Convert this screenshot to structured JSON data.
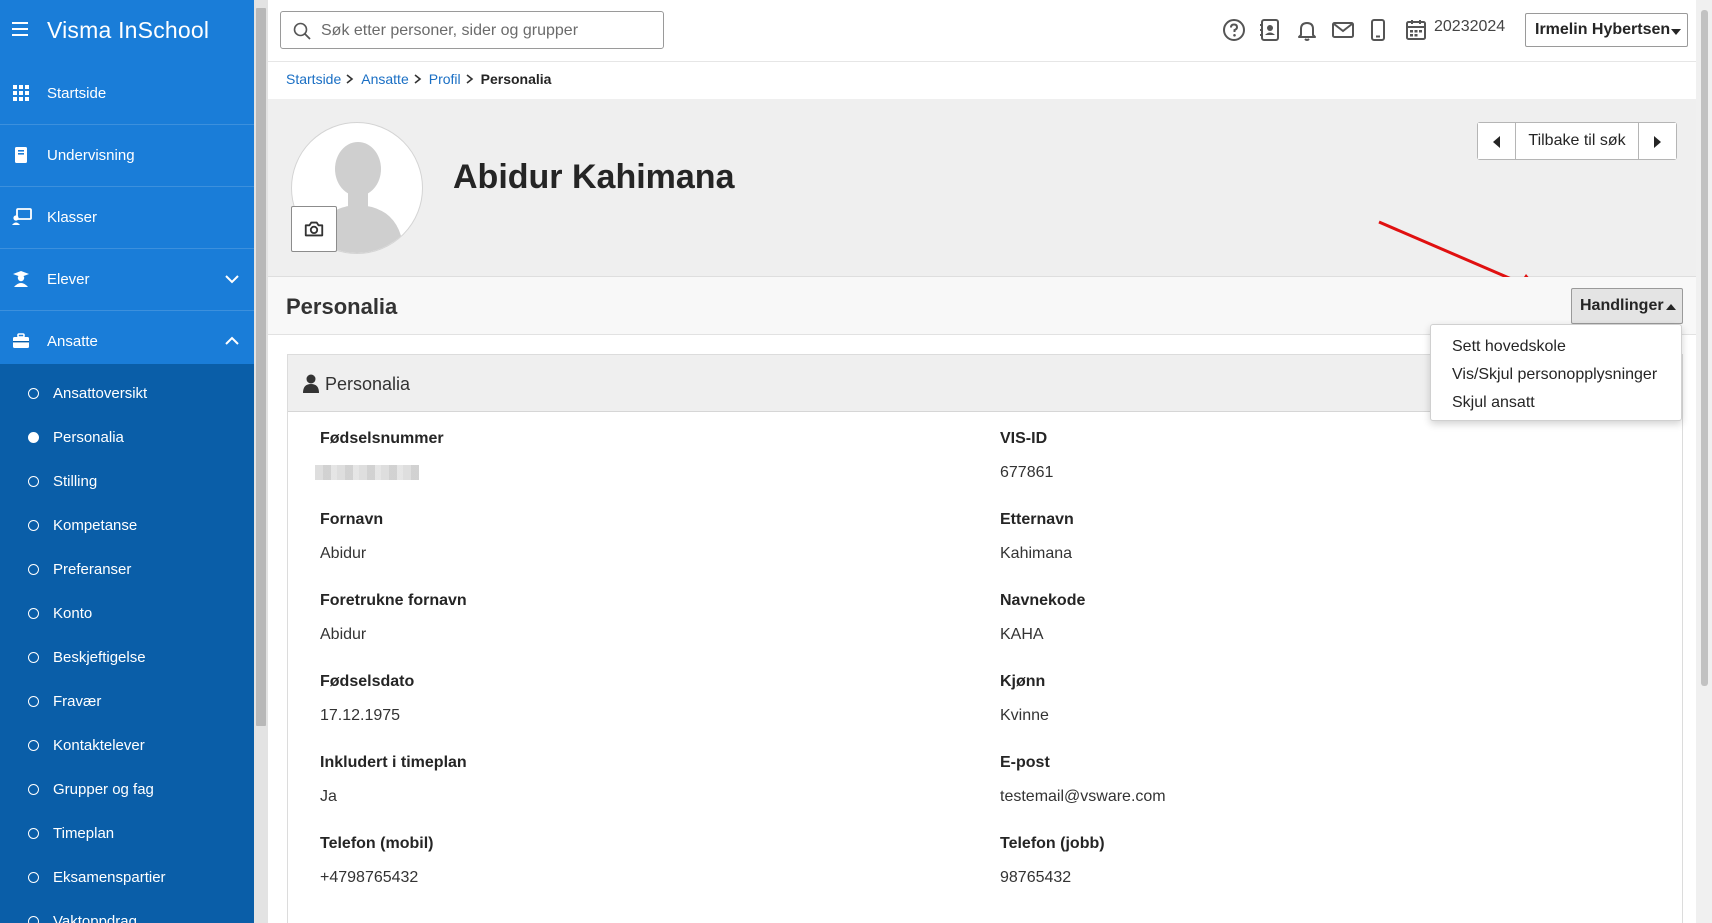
{
  "app": {
    "title": "Visma InSchool"
  },
  "sidebar": {
    "items": [
      {
        "label": "Startside"
      },
      {
        "label": "Undervisning"
      },
      {
        "label": "Klasser"
      },
      {
        "label": "Elever"
      },
      {
        "label": "Ansatte"
      }
    ],
    "subitems": [
      {
        "label": "Ansattoversikt",
        "active": false
      },
      {
        "label": "Personalia",
        "active": true
      },
      {
        "label": "Stilling",
        "active": false
      },
      {
        "label": "Kompetanse",
        "active": false
      },
      {
        "label": "Preferanser",
        "active": false
      },
      {
        "label": "Konto",
        "active": false
      },
      {
        "label": "Beskjeftigelse",
        "active": false
      },
      {
        "label": "Fravær",
        "active": false
      },
      {
        "label": "Kontaktelever",
        "active": false
      },
      {
        "label": "Grupper og fag",
        "active": false
      },
      {
        "label": "Timeplan",
        "active": false
      },
      {
        "label": "Eksamenspartier",
        "active": false
      },
      {
        "label": "Vaktoppdrag",
        "active": false
      }
    ]
  },
  "topbar": {
    "search_placeholder": "Søk etter personer, sider og grupper",
    "school_year": "20232024",
    "user_name": "Irmelin Hybertsen"
  },
  "breadcrumb": {
    "items": [
      "Startside",
      "Ansatte",
      "Profil"
    ],
    "current": "Personalia"
  },
  "profile": {
    "name": "Abidur Kahimana",
    "back_label": "Tilbake til søk"
  },
  "section": {
    "title": "Personalia",
    "actions_label": "Handlinger",
    "actions_menu": [
      "Sett hovedskole",
      "Vis/Skjul personopplysninger",
      "Skjul ansatt"
    ]
  },
  "card": {
    "title": "Personalia",
    "fields_left": [
      {
        "label": "Fødselsnummer",
        "value": ""
      },
      {
        "label": "Fornavn",
        "value": "Abidur"
      },
      {
        "label": "Foretrukne fornavn",
        "value": "Abidur"
      },
      {
        "label": "Fødselsdato",
        "value": "17.12.1975"
      },
      {
        "label": "Inkludert i timeplan",
        "value": "Ja"
      },
      {
        "label": "Telefon (mobil)",
        "value": "+4798765432"
      }
    ],
    "fields_right": [
      {
        "label": "VIS-ID",
        "value": "677861"
      },
      {
        "label": "Etternavn",
        "value": "Kahimana"
      },
      {
        "label": "Navnekode",
        "value": "KAHA"
      },
      {
        "label": "Kjønn",
        "value": "Kvinne"
      },
      {
        "label": "E-post",
        "value": "testemail@vsware.com"
      },
      {
        "label": "Telefon (jobb)",
        "value": "98765432"
      }
    ]
  },
  "colors": {
    "sidebar_top": "#1a7dd8",
    "sidebar_bottom": "#0a5ea8",
    "link": "#1a6fc4",
    "annotation_arrow": "#e01010"
  }
}
